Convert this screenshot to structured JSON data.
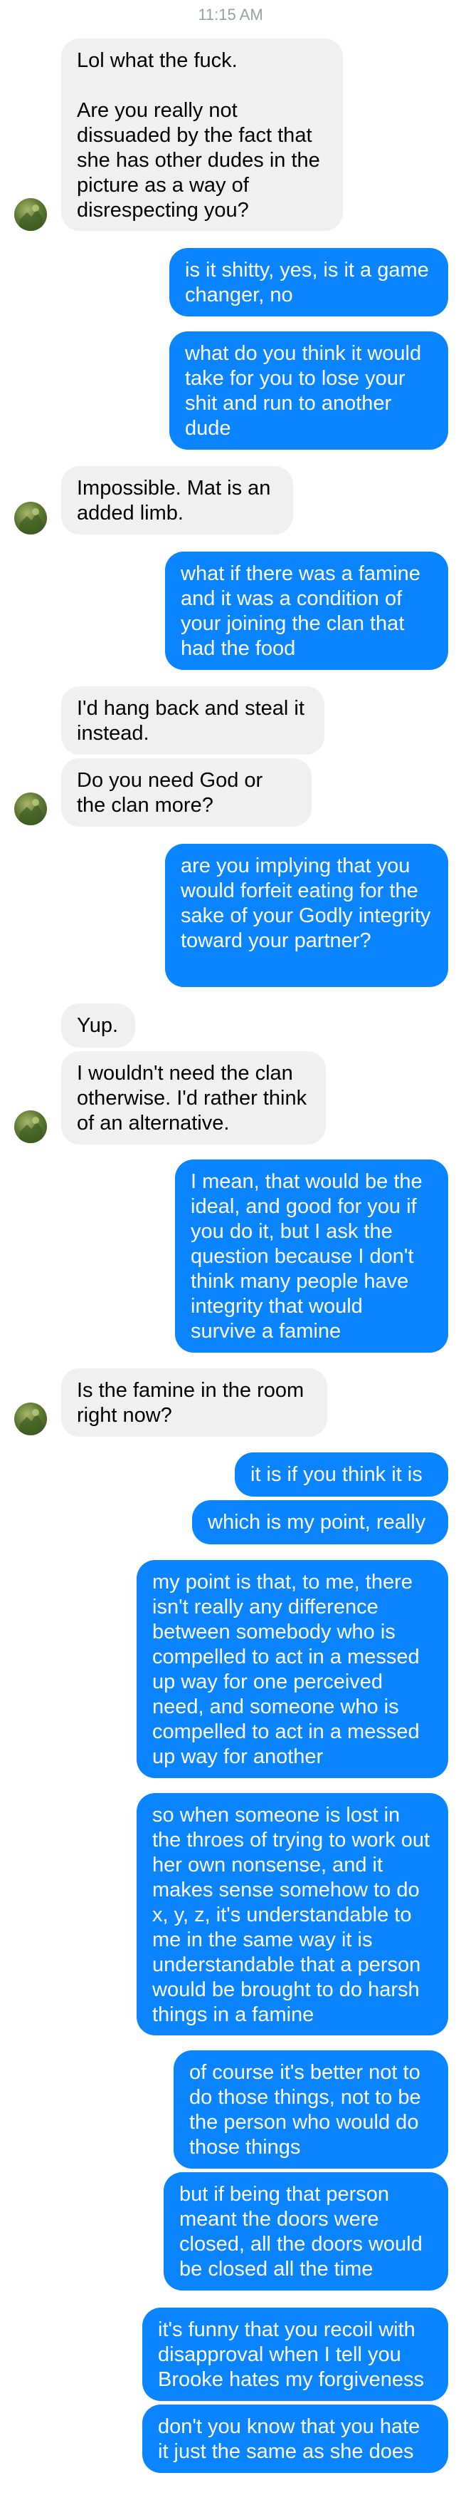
{
  "status": {
    "time": "11:15 AM"
  },
  "messages": [
    {
      "side": "in",
      "text": "Lol what the fuck.\n\nAre you really not dissuaded by the fact that she has other dudes in the picture as a way of disrespecting you?"
    },
    {
      "side": "out",
      "text": "is it shitty, yes, is it a game changer, no"
    },
    {
      "side": "out",
      "text": "what do you think it would take for you to lose your shit and run to another dude"
    },
    {
      "side": "in",
      "text": "Impossible. Mat is an added limb."
    },
    {
      "side": "out",
      "text": "what if there was a famine and it was a condition of your joining the clan that had the food"
    },
    {
      "side": "in",
      "text": "I'd hang back and steal it instead."
    },
    {
      "side": "in",
      "text": "Do you need God or the clan more?"
    },
    {
      "side": "out",
      "text": "are you implying that you would forfeit eating for the sake of your Godly integrity toward your partner?"
    },
    {
      "side": "in",
      "text": "Yup."
    },
    {
      "side": "in",
      "text": "I wouldn't need the clan otherwise. I'd rather think of an alternative."
    },
    {
      "side": "out",
      "text": "I mean, that would be the ideal, and good for you if you do it, but I ask the question because I don't think many people have integrity that would survive a famine"
    },
    {
      "side": "in",
      "text": "Is the famine in the room right now?"
    },
    {
      "side": "out",
      "text": "it is if you think it is"
    },
    {
      "side": "out",
      "text": "which is my point, really"
    },
    {
      "side": "out",
      "text": "my point is that, to me, there isn't really any difference between somebody who is compelled to act in a messed up way for one perceived need, and someone who is compelled to act in a messed up way for another"
    },
    {
      "side": "out",
      "text": "so when someone is lost in the throes of trying to work out her own nonsense, and it makes sense somehow to do x, y, z, it's understandable to me in the same way it is understandable that a person would be brought to do harsh things in a famine"
    },
    {
      "side": "out",
      "text": "of course it's better not to do those things, not to be the person who would do those things"
    },
    {
      "side": "out",
      "text": "but if being that person meant the doors were closed, all the doors would be closed all the time"
    },
    {
      "side": "out",
      "text": "it's funny that you recoil with disapproval when I tell you Brooke hates my forgiveness"
    },
    {
      "side": "out",
      "text": "don't you know that you hate it just the same as she does"
    }
  ]
}
